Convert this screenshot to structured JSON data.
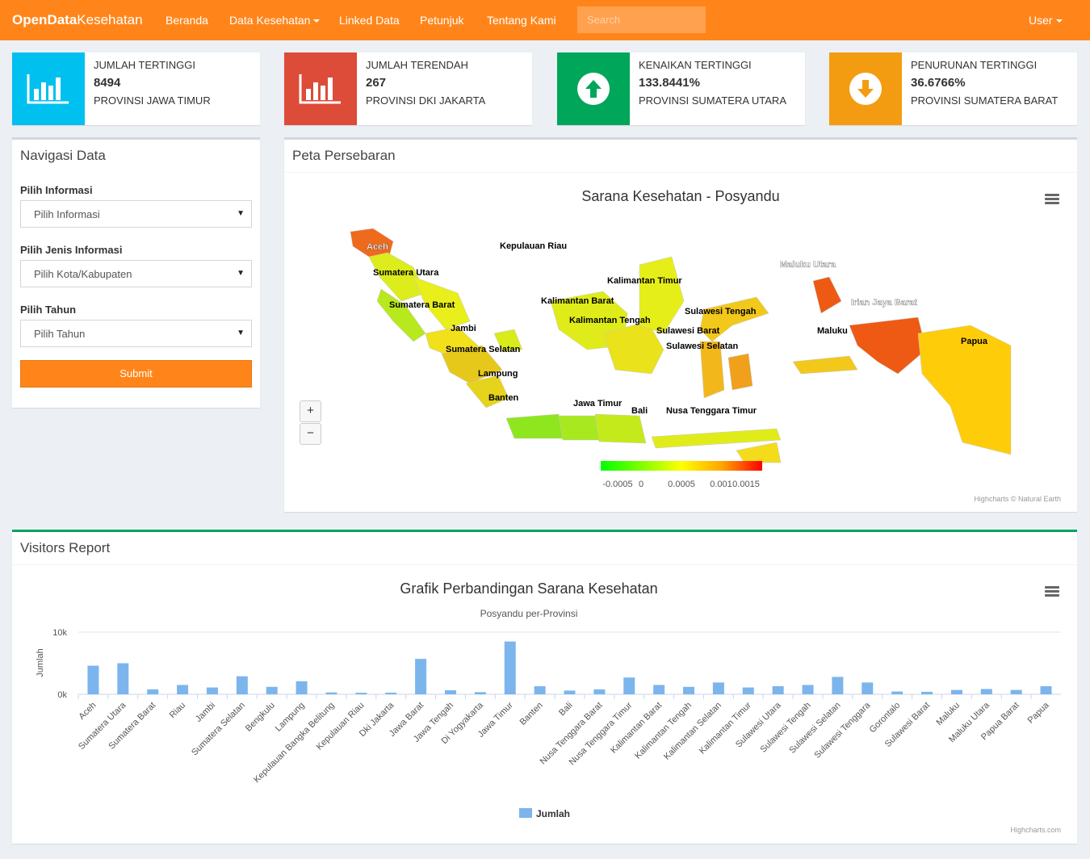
{
  "navbar": {
    "brand_bold": "OpenData",
    "brand_light": "Kesehatan",
    "items": [
      "Beranda",
      "Data Kesehatan",
      "Linked Data",
      "Petunjuk",
      "Tentang Kami"
    ],
    "search_placeholder": "Search",
    "user": "User"
  },
  "info_boxes": [
    {
      "label": "JUMLAH TERTINGGI",
      "value": "8494",
      "desc": "PROVINSI JAWA TIMUR",
      "color": "#00c0ef",
      "icon": "bar-chart-icon"
    },
    {
      "label": "JUMLAH TERENDAH",
      "value": "267",
      "desc": "PROVINSI DKI JAKARTA",
      "color": "#dd4b39",
      "icon": "bar-chart-icon"
    },
    {
      "label": "KENAIKAN TERTINGGI",
      "value": "133.8441%",
      "desc": "PROVINSI SUMATERA UTARA",
      "color": "#00a65a",
      "icon": "arrow-up-circle-icon"
    },
    {
      "label": "PENURUNAN TERTINGGI",
      "value": "36.6766%",
      "desc": "PROVINSI SUMATERA BARAT",
      "color": "#f39c12",
      "icon": "arrow-down-circle-icon"
    }
  ],
  "nav_data": {
    "title": "Navigasi Data",
    "info_label": "Pilih Informasi",
    "info_value": "Pilih Informasi",
    "jenis_label": "Pilih Jenis Informasi",
    "jenis_value": "Pilih Kota/Kabupaten",
    "tahun_label": "Pilih Tahun",
    "tahun_value": "Pilih Tahun",
    "submit": "Submit"
  },
  "map": {
    "box_title": "Peta Persebaran",
    "title": "Sarana Kesehatan - Posyandu",
    "zoom_in": "+",
    "zoom_out": "−",
    "legend_ticks": [
      "-0.0005",
      "0",
      "0.0005",
      "0.001",
      "0.0015"
    ],
    "credits": "Highcharts © Natural Earth",
    "color_min": "#00ff00",
    "color_max": "#ff0000",
    "regions": [
      {
        "name": "Aceh",
        "label_color": "#fff"
      },
      {
        "name": "Sumatera Utara",
        "label_color": "#000"
      },
      {
        "name": "Sumatera Barat",
        "label_color": "#000"
      },
      {
        "name": "Kepulauan Riau",
        "label_color": "#000"
      },
      {
        "name": "Jambi",
        "label_color": "#000"
      },
      {
        "name": "Sumatera Selatan",
        "label_color": "#000"
      },
      {
        "name": "Lampung",
        "label_color": "#000"
      },
      {
        "name": "Banten",
        "label_color": "#000"
      },
      {
        "name": "Jawa Timur",
        "label_color": "#000"
      },
      {
        "name": "Bali",
        "label_color": "#000"
      },
      {
        "name": "Nusa Tenggara Timur",
        "label_color": "#000"
      },
      {
        "name": "Kalimantan Timur",
        "label_color": "#000"
      },
      {
        "name": "Kalimantan Barat",
        "label_color": "#000"
      },
      {
        "name": "Kalimantan Tengah",
        "label_color": "#000"
      },
      {
        "name": "Sulawesi Tengah",
        "label_color": "#000"
      },
      {
        "name": "Sulawesi Barat",
        "label_color": "#000"
      },
      {
        "name": "Sulawesi Selatan",
        "label_color": "#000"
      },
      {
        "name": "Maluku Utara",
        "label_color": "#fff"
      },
      {
        "name": "Irian Jaya Barat",
        "label_color": "#fff"
      },
      {
        "name": "Maluku",
        "label_color": "#000"
      },
      {
        "name": "Papua",
        "label_color": "#000"
      }
    ]
  },
  "visitors": {
    "box_title": "Visitors Report",
    "credits": "Highcharts.com"
  },
  "chart_data": {
    "type": "bar",
    "title": "Grafik Perbandingan Sarana Kesehatan",
    "subtitle": "Posyandu per-Provinsi",
    "ylabel": "Jumlah",
    "ylim": [
      0,
      10000
    ],
    "yticks": [
      "0k",
      "10k"
    ],
    "legend": "top-center-bottom",
    "color": "#7cb5ec",
    "categories": [
      "Aceh",
      "Sumatera Utara",
      "Sumatera Barat",
      "Riau",
      "Jambi",
      "Sumatera Selatan",
      "Bengkulu",
      "Lampung",
      "Kepulauan Bangka Belitung",
      "Kepulauan Riau",
      "Dki Jakarta",
      "Jawa Barat",
      "Jawa Tengah",
      "Di Yogyakarta",
      "Jawa Timur",
      "Banten",
      "Bali",
      "Nusa Tenggara Barat",
      "Nusa Tenggara Timur",
      "Kalimantan Barat",
      "Kalimantan Tengah",
      "Kalimantan Selatan",
      "Kalimantan Timur",
      "Sulawesi Utara",
      "Sulawesi Tengah",
      "Sulawesi Selatan",
      "Sulawesi Tenggara",
      "Gorontalo",
      "Sulawesi Barat",
      "Maluku",
      "Maluku Utara",
      "Papua Barat",
      "Papua"
    ],
    "series": [
      {
        "name": "Jumlah",
        "values": [
          4600,
          5000,
          800,
          1500,
          1100,
          2900,
          1200,
          2100,
          300,
          250,
          267,
          5700,
          650,
          350,
          8494,
          1300,
          600,
          800,
          2700,
          1500,
          1200,
          1900,
          1100,
          1300,
          1500,
          2800,
          1900,
          450,
          400,
          700,
          850,
          700,
          1300
        ]
      }
    ]
  }
}
